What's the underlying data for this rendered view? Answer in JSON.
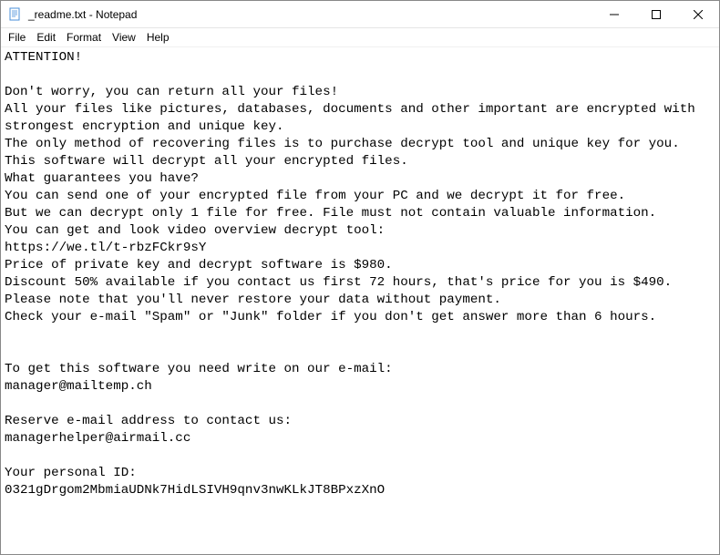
{
  "titlebar": {
    "title": "_readme.txt - Notepad"
  },
  "menubar": {
    "items": [
      "File",
      "Edit",
      "Format",
      "View",
      "Help"
    ]
  },
  "content": {
    "text": "ATTENTION!\n\nDon't worry, you can return all your files!\nAll your files like pictures, databases, documents and other important are encrypted with strongest encryption and unique key.\nThe only method of recovering files is to purchase decrypt tool and unique key for you.\nThis software will decrypt all your encrypted files.\nWhat guarantees you have?\nYou can send one of your encrypted file from your PC and we decrypt it for free.\nBut we can decrypt only 1 file for free. File must not contain valuable information.\nYou can get and look video overview decrypt tool:\nhttps://we.tl/t-rbzFCkr9sY\nPrice of private key and decrypt software is $980.\nDiscount 50% available if you contact us first 72 hours, that's price for you is $490.\nPlease note that you'll never restore your data without payment.\nCheck your e-mail \"Spam\" or \"Junk\" folder if you don't get answer more than 6 hours.\n\n\nTo get this software you need write on our e-mail:\nmanager@mailtemp.ch\n\nReserve e-mail address to contact us:\nmanagerhelper@airmail.cc\n\nYour personal ID:\n0321gDrgom2MbmiaUDNk7HidLSIVH9qnv3nwKLkJT8BPxzXnO"
  }
}
